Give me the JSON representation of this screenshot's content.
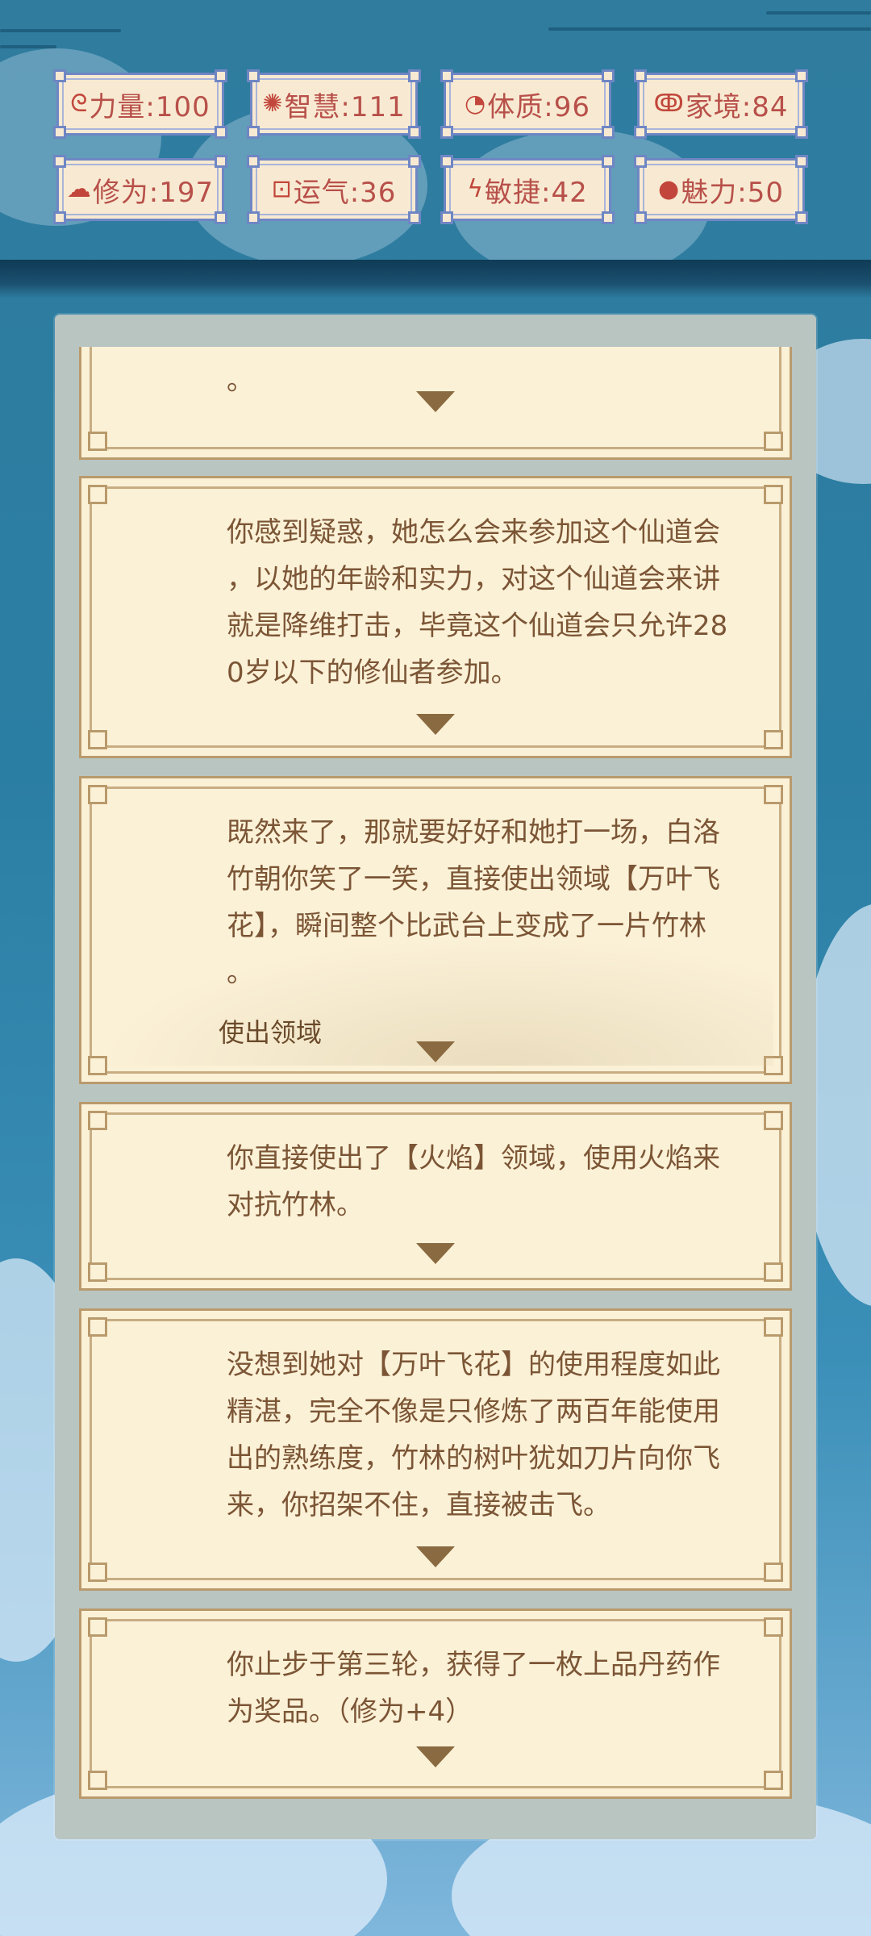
{
  "stats": [
    {
      "icon": "strength-icon",
      "glyph": "ᘓ",
      "label": "力量:100"
    },
    {
      "icon": "wisdom-icon",
      "glyph": "✺",
      "label": "智慧:111"
    },
    {
      "icon": "constitution-icon",
      "glyph": "◔",
      "label": "体质:96"
    },
    {
      "icon": "family-icon",
      "glyph": "ↂ",
      "label": "家境:84"
    },
    {
      "icon": "cultivation-icon",
      "glyph": "☁",
      "label": "修为:197"
    },
    {
      "icon": "luck-icon",
      "glyph": "⊡",
      "label": "运气:36"
    },
    {
      "icon": "agility-icon",
      "glyph": "ϟ",
      "label": "敏捷:42"
    },
    {
      "icon": "charm-icon",
      "glyph": "●",
      "label": "魅力:50"
    }
  ],
  "log": [
    {
      "text": "。"
    },
    {
      "text": "你感到疑惑，她怎么会来参加这个仙道会\n，以她的年龄和实力，对这个仙道会来讲\n就是降维打击，毕竟这个仙道会只允许28\n0岁以下的修仙者参加。"
    },
    {
      "text": "既然来了，那就要好好和她打一场，白洛\n竹朝你笑了一笑，直接使出领域【万叶飞\n花】，瞬间整个比武台上变成了一片竹林\n。",
      "choice": "使出领域"
    },
    {
      "text": "你直接使出了【火焰】领域，使用火焰来\n对抗竹林。"
    },
    {
      "text": "没想到她对【万叶飞花】的使用程度如此\n精湛，完全不像是只修炼了两百年能使用\n出的熟练度，竹林的树叶犹如刀片向你飞\n来，你招架不住，直接被击飞。"
    },
    {
      "text": "你止步于第三轮，获得了一枚上品丹药作\n为奖品。（修为+4）"
    }
  ],
  "colors": {
    "stat_text": "#b8504a",
    "log_text": "#7b5535",
    "card_bg": "#fbf1d7"
  }
}
